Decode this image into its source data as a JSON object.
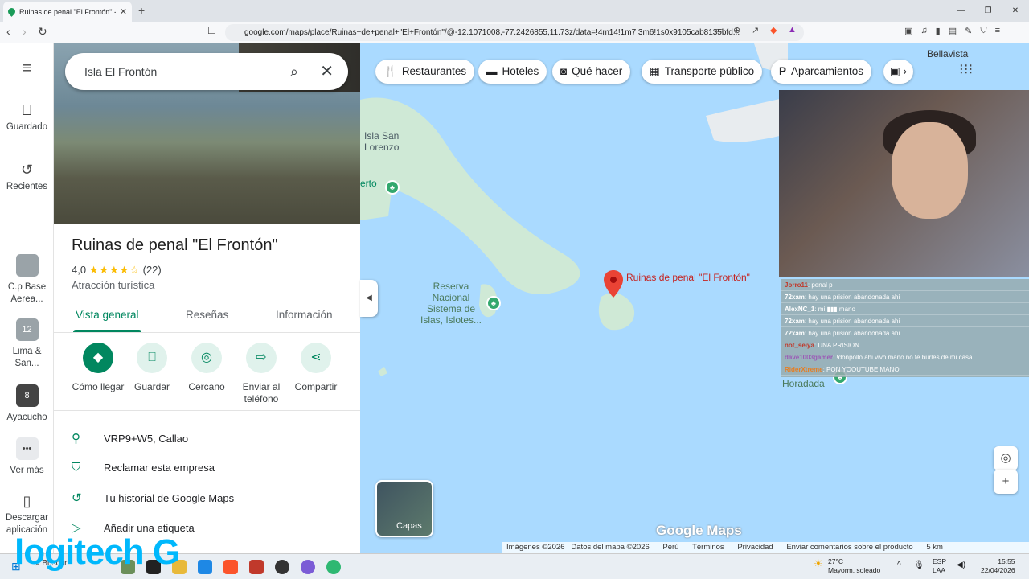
{
  "browser": {
    "tab_title": "Ruinas de penal \"El Frontón\" - G",
    "url": "google.com/maps/place/Ruinas+de+penal+\"El+Frontón\"/@-12.1071008,-77.2426855,11.73z/data=!4m14!1m7!3m6!1s0x9105cab8135bfd..."
  },
  "rail": {
    "saved": "Guardado",
    "recent": "Recientes",
    "item1": "C.p Base Aerea...",
    "item2": "Lima & San...",
    "item2_badge": "12",
    "item3": "Ayacucho",
    "item3_badge": "8",
    "more": "Ver más",
    "download": "Descargar aplicación"
  },
  "search": {
    "value": "Isla El Frontón"
  },
  "place": {
    "title": "Ruinas de penal \"El Frontón\"",
    "rating": "4,0",
    "stars": "★★★★☆",
    "reviews": "(22)",
    "category": "Atracción turística"
  },
  "tabs": [
    "Vista general",
    "Reseñas",
    "Información"
  ],
  "actions": [
    "Cómo llegar",
    "Guardar",
    "Cercano",
    "Enviar al teléfono",
    "Compartir"
  ],
  "info": [
    "VRP9+W5, Callao",
    "Reclamar esta empresa",
    "Tu historial de Google Maps",
    "Añadir una etiqueta"
  ],
  "chips": [
    "Restaurantes",
    "Hoteles",
    "Qué hacer",
    "Transporte público",
    "Aparcamientos"
  ],
  "map_labels": {
    "bellavista": "Bellavista",
    "san_lorenzo": "Isla San Lorenzo",
    "reserva": "Reserva Nacional Sistema de Islas, Islotes...",
    "pin": "Ruinas de penal \"El Frontón\"",
    "horadada": "Horadada",
    "erto": "erto",
    "layers": "Capas",
    "google_maps": "Google Maps"
  },
  "chat": [
    {
      "user": "Jorro11",
      "msg": ": penal p",
      "color": "#c0392b"
    },
    {
      "user": "72xam",
      "msg": ": hay una prision abandonada ahi",
      "color": "#ffffff"
    },
    {
      "user": "AlexNC_1",
      "msg": ": mi ▮▮▮ mano",
      "color": "#ffffff"
    },
    {
      "user": "72xam",
      "msg": ": hay una prision abandonada ahi",
      "color": "#ffffff"
    },
    {
      "user": "72xam",
      "msg": ": hay una prision abandonada ahi",
      "color": "#ffffff"
    },
    {
      "user": "not_seiya",
      "msg": ": UNA PRISION",
      "color": "#c0392b"
    },
    {
      "user": "dave1003gamer",
      "msg": ": !donpollo ahi vivo mano no te burles de mi casa",
      "color": "#9b59b6"
    },
    {
      "user": "RiderXtreme",
      "msg": ": PON YOOUTUBE MANO",
      "color": "#e67e22"
    }
  ],
  "footer": {
    "imagery": "Imágenes ©2026 , Datos del mapa ©2026",
    "country": "Perú",
    "terms": "Términos",
    "privacy": "Privacidad",
    "feedback": "Enviar comentarios sobre el producto",
    "scale": "5 km"
  },
  "taskbar": {
    "search": "Buscar",
    "weather_temp": "27°C",
    "weather_desc": "Mayorm. soleado",
    "lang1": "ESP",
    "lang2": "LAA",
    "time": "15:55",
    "date": "22/04/2026"
  },
  "overlay": {
    "logo": "logitech G"
  },
  "colors": {
    "accent": "#01875f",
    "pin": "#c5221f",
    "water": "#aadaff",
    "land": "#cfe9d6"
  }
}
